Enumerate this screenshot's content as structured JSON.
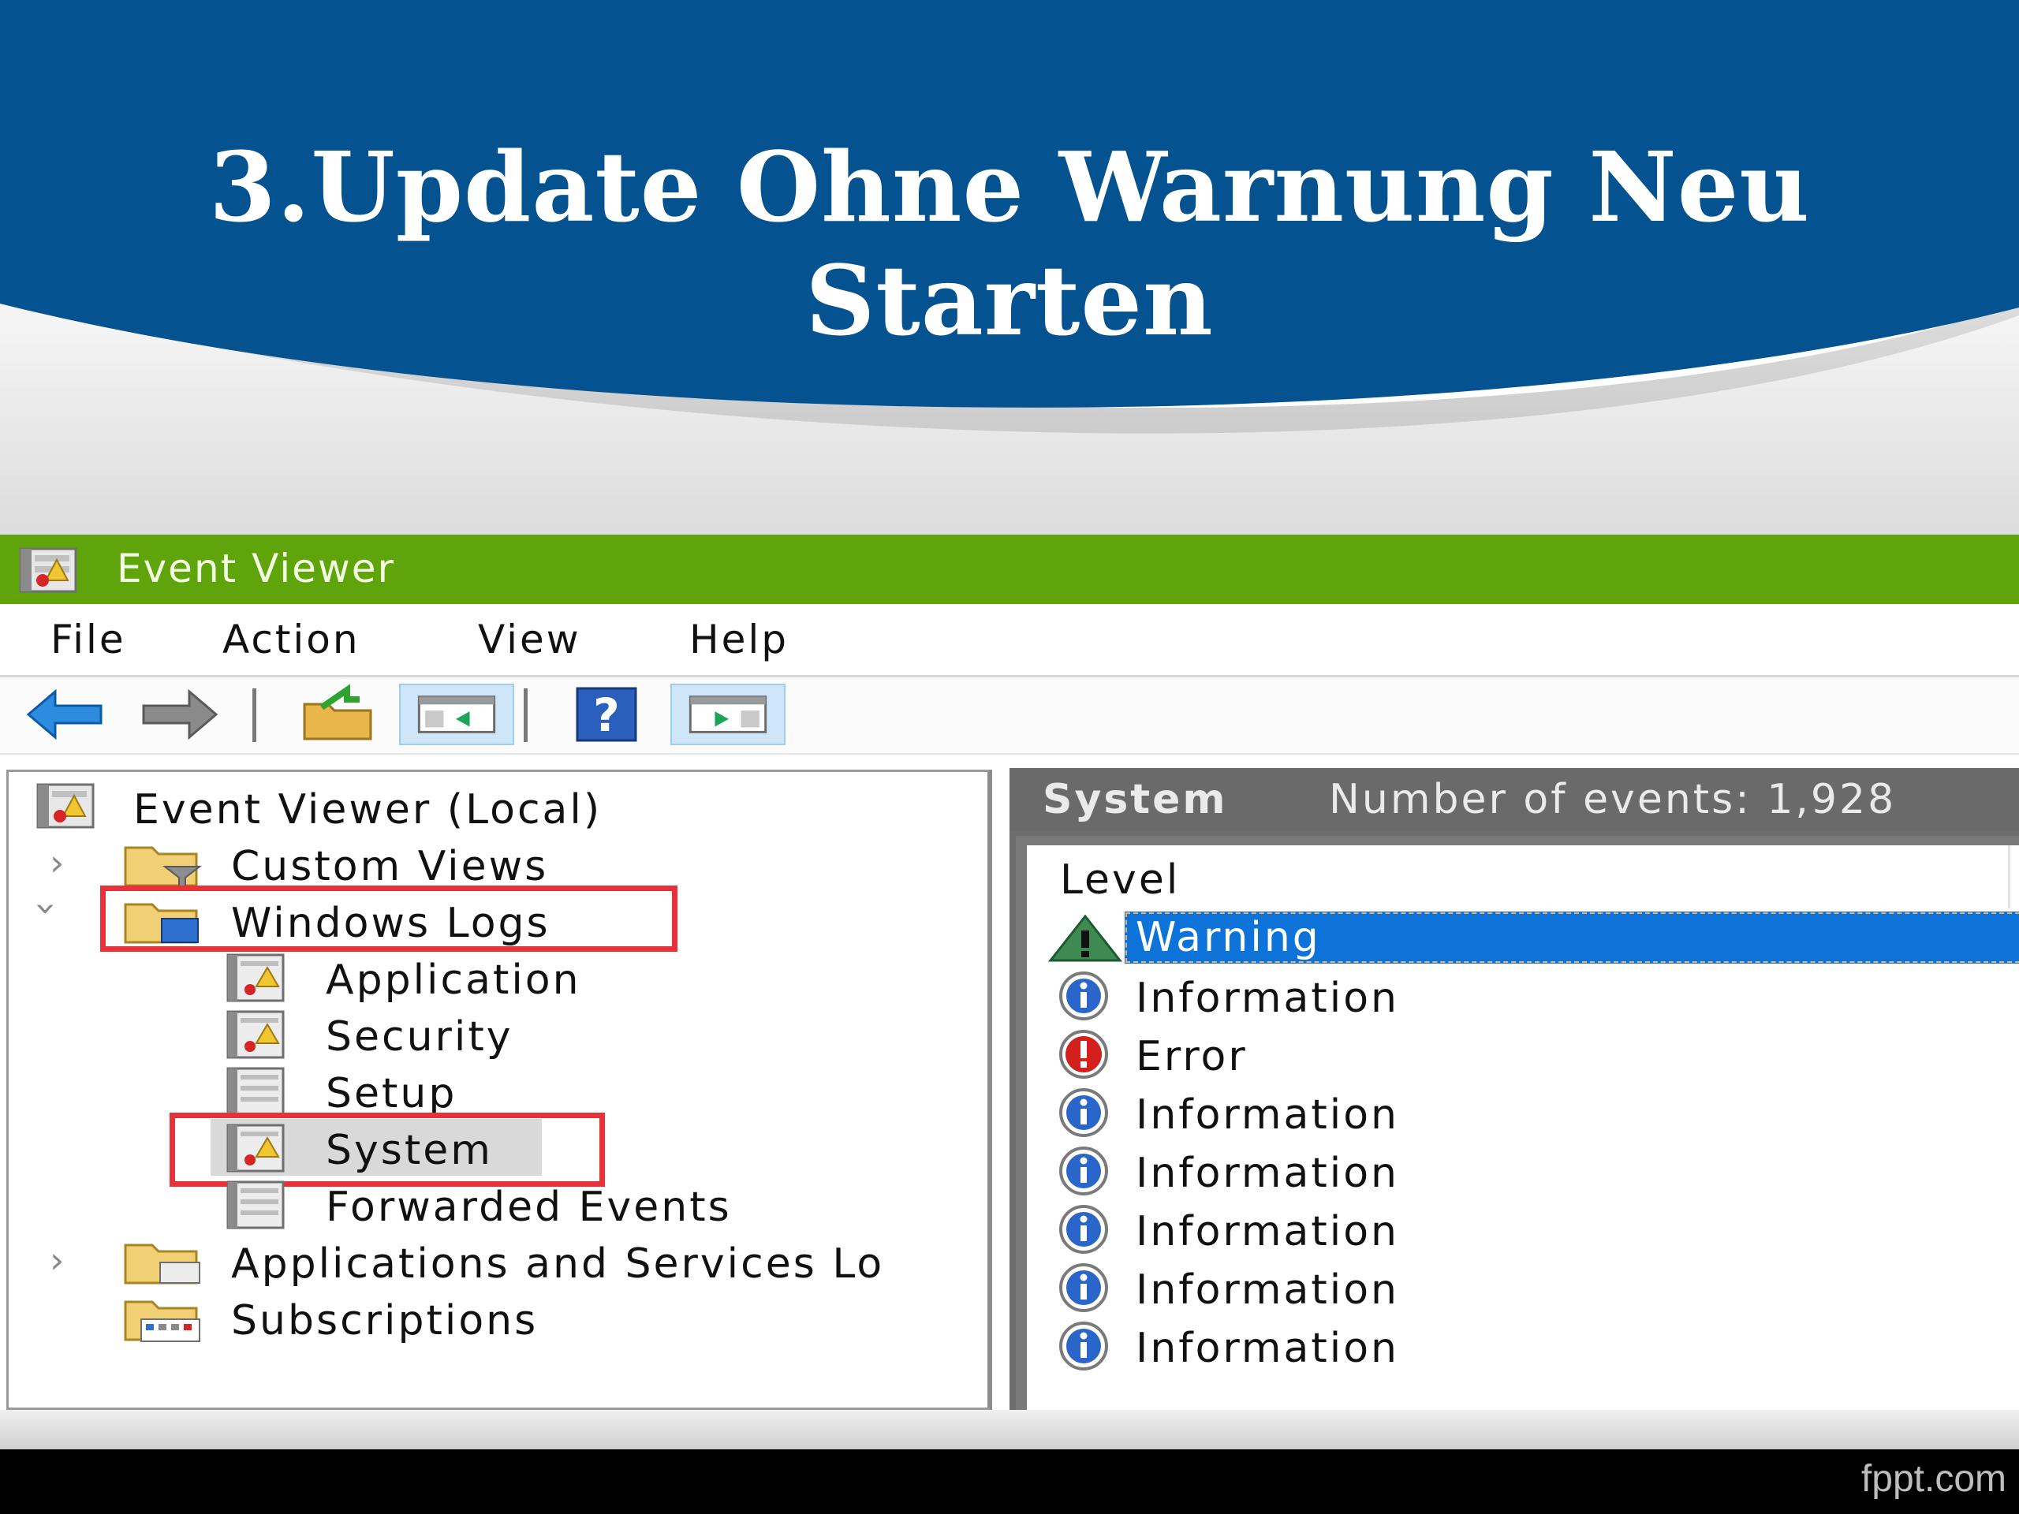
{
  "slide": {
    "title": "3.Update Ohne Warnung Neu Starten",
    "watermark": "fppt.com"
  },
  "window": {
    "title": "Event Viewer",
    "menu": [
      "File",
      "Action",
      "View",
      "Help"
    ],
    "toolbar": [
      "back-arrow-icon",
      "forward-arrow-icon",
      "open-folder-icon",
      "show-hide-console-tree-icon",
      "help-icon",
      "show-hide-action-pane-icon"
    ]
  },
  "tree": {
    "root": "Event Viewer (Local)",
    "custom_views": "Custom Views",
    "windows_logs": "Windows Logs",
    "application": "Application",
    "security": "Security",
    "setup": "Setup",
    "system": "System",
    "forwarded": "Forwarded Events",
    "apps_services": "Applications and Services Lo",
    "subscriptions": "Subscriptions"
  },
  "events": {
    "log_name": "System",
    "count_label": "Number of events: 1,928",
    "column_level": "Level",
    "rows": [
      {
        "level": "Warning",
        "icon": "warning-icon",
        "selected": true
      },
      {
        "level": "Information",
        "icon": "info-icon"
      },
      {
        "level": "Error",
        "icon": "error-icon"
      },
      {
        "level": "Information",
        "icon": "info-icon"
      },
      {
        "level": "Information",
        "icon": "info-icon"
      },
      {
        "level": "Information",
        "icon": "info-icon"
      },
      {
        "level": "Information",
        "icon": "info-icon"
      },
      {
        "level": "Information",
        "icon": "info-icon"
      }
    ]
  },
  "colors": {
    "header_blue": "#04528f",
    "titlebar_green": "#5ea40a",
    "highlight_red": "#e8323a",
    "selection_blue": "#0d73d9"
  }
}
